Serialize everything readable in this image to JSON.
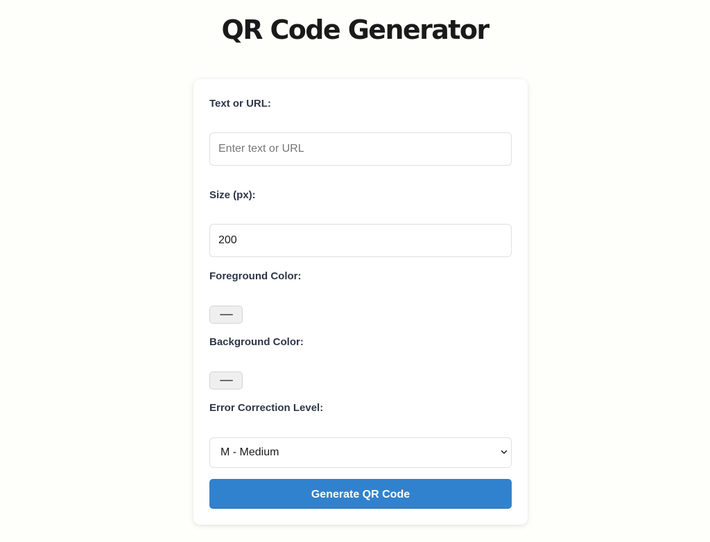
{
  "page": {
    "title": "QR Code Generator"
  },
  "form": {
    "text_label": "Text or URL:",
    "text_placeholder": "Enter text or URL",
    "text_value": "",
    "size_label": "Size (px):",
    "size_value": "200",
    "foreground_label": "Foreground Color:",
    "foreground_color": "#000000",
    "background_label": "Background Color:",
    "background_color": "#ffffff",
    "error_label": "Error Correction Level:",
    "error_selected": "M - Medium",
    "generate_label": "Generate QR Code"
  },
  "icons": {
    "select_chevron": "chevron-down-icon"
  },
  "colors": {
    "accent": "#3182ce",
    "page_background": "#fefefb",
    "card_background": "#ffffff",
    "label_text": "#2d3748"
  }
}
